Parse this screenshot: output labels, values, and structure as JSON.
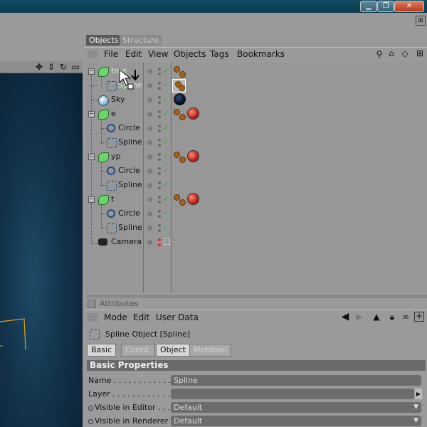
{
  "window": {
    "buttons": {
      "minimize": "▁",
      "restore": "❐",
      "close": "✕"
    }
  },
  "object_manager": {
    "tabs": [
      "Objects",
      "Structure"
    ],
    "menu": [
      "File",
      "Edit",
      "View",
      "Objects",
      "Tags",
      "Bookmarks"
    ],
    "objects": [
      {
        "name": "tree",
        "type": "null"
      },
      {
        "name": "Spline",
        "type": "spline"
      },
      {
        "name": "Sky",
        "type": "sky"
      },
      {
        "name": "e",
        "type": "null"
      },
      {
        "name": "Circle",
        "type": "circle"
      },
      {
        "name": "Spline",
        "type": "spline"
      },
      {
        "name": "yp",
        "type": "null"
      },
      {
        "name": "Circle",
        "type": "circle"
      },
      {
        "name": "Spline",
        "type": "spline"
      },
      {
        "name": "t",
        "type": "null"
      },
      {
        "name": "Circle",
        "type": "circle"
      },
      {
        "name": "Spline",
        "type": "spline"
      },
      {
        "name": "Camera",
        "type": "camera"
      }
    ]
  },
  "attributes": {
    "header": "Attributes",
    "menu": [
      "Mode",
      "Edit",
      "User Data"
    ],
    "object_title": "Spline Object [Spline]",
    "tabs": [
      "Basic",
      "Coord.",
      "Object",
      "Metaball"
    ],
    "active_tab": "Object",
    "section": "Basic Properties",
    "props": {
      "name_label": "Name . . . . . . . . . . . .",
      "name_value": "Spline",
      "layer_label": "Layer . . . . . . . . . . . .",
      "vis_editor_label": "Visible in Editor . . .",
      "vis_editor_value": "Default",
      "vis_renderer_label": "Visible in Renderer . .",
      "vis_renderer_value": "Default"
    }
  },
  "colors": {
    "accent_check": "#2fae3b",
    "material": "#c3281b",
    "tag": "#a7621c"
  }
}
